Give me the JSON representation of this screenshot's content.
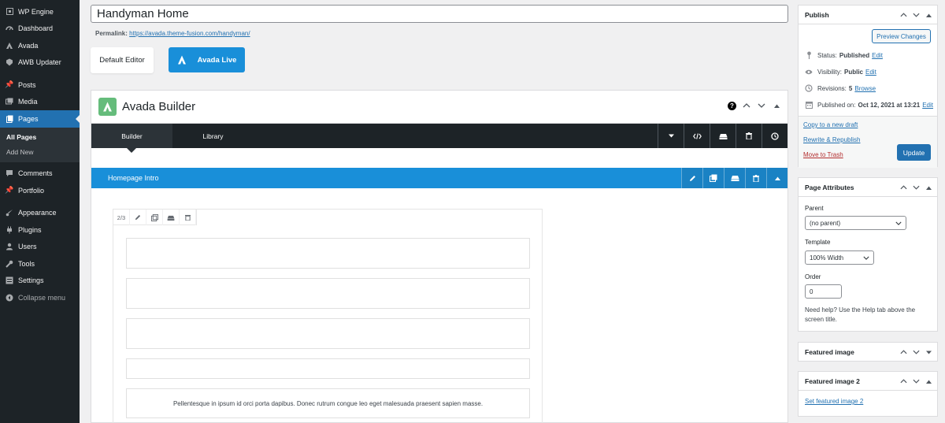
{
  "sidebar": {
    "items": [
      {
        "label": "WP Engine",
        "icon": "wp-engine-icon"
      },
      {
        "label": "Dashboard",
        "icon": "dashboard-icon"
      },
      {
        "label": "Avada",
        "icon": "avada-icon"
      },
      {
        "label": "AWB Updater",
        "icon": "awb-updater-icon"
      },
      {
        "label": "Posts",
        "icon": "pin-icon"
      },
      {
        "label": "Media",
        "icon": "media-icon"
      },
      {
        "label": "Pages",
        "icon": "pages-icon"
      },
      {
        "label": "Comments",
        "icon": "comment-icon"
      },
      {
        "label": "Portfolio",
        "icon": "portfolio-icon"
      },
      {
        "label": "Appearance",
        "icon": "brush-icon"
      },
      {
        "label": "Plugins",
        "icon": "plugin-icon"
      },
      {
        "label": "Users",
        "icon": "users-icon"
      },
      {
        "label": "Tools",
        "icon": "wrench-icon"
      },
      {
        "label": "Settings",
        "icon": "settings-icon"
      },
      {
        "label": "Collapse menu",
        "icon": "collapse-icon"
      }
    ],
    "submenu": [
      "All Pages",
      "Add New"
    ]
  },
  "editor": {
    "title": "Handyman Home",
    "permalink_label": "Permalink:",
    "permalink_url": "https://avada.theme-fusion.com/handyman/",
    "default_editor_label": "Default Editor",
    "avada_live_label": "Avada Live"
  },
  "builder": {
    "title": "Avada Builder",
    "help": "?",
    "tabs": [
      "Builder",
      "Library"
    ],
    "section_title": "Homepage Intro",
    "column_size": "2/3",
    "paragraph_text": "Pellentesque in ipsum id orci porta dapibus. Donec rutrum congue leo eget malesuada praesent sapien masse."
  },
  "publish": {
    "title": "Publish",
    "preview_label": "Preview Changes",
    "status_label": "Status:",
    "status_value": "Published",
    "visibility_label": "Visibility:",
    "visibility_value": "Public",
    "revisions_label": "Revisions:",
    "revisions_value": "5",
    "browse_label": "Browse",
    "published_on_label": "Published on:",
    "published_on_value": "Oct 12, 2021 at 13:21",
    "edit_label": "Edit",
    "copy_draft": "Copy to a new draft",
    "rewrite": "Rewrite & Republish",
    "trash": "Move to Trash",
    "update_label": "Update"
  },
  "page_attributes": {
    "title": "Page Attributes",
    "parent_label": "Parent",
    "parent_value": "(no parent)",
    "template_label": "Template",
    "template_value": "100% Width",
    "order_label": "Order",
    "order_value": "0",
    "help_text": "Need help? Use the Help tab above the screen title."
  },
  "featured_image": {
    "title": "Featured image"
  },
  "featured_image_2": {
    "title": "Featured image 2",
    "set_link": "Set featured image 2"
  },
  "colors": {
    "sidebar": "#1d2327",
    "accent": "#2271b1",
    "avada_blue": "#198fd9",
    "avada_green": "#65bc7b"
  }
}
